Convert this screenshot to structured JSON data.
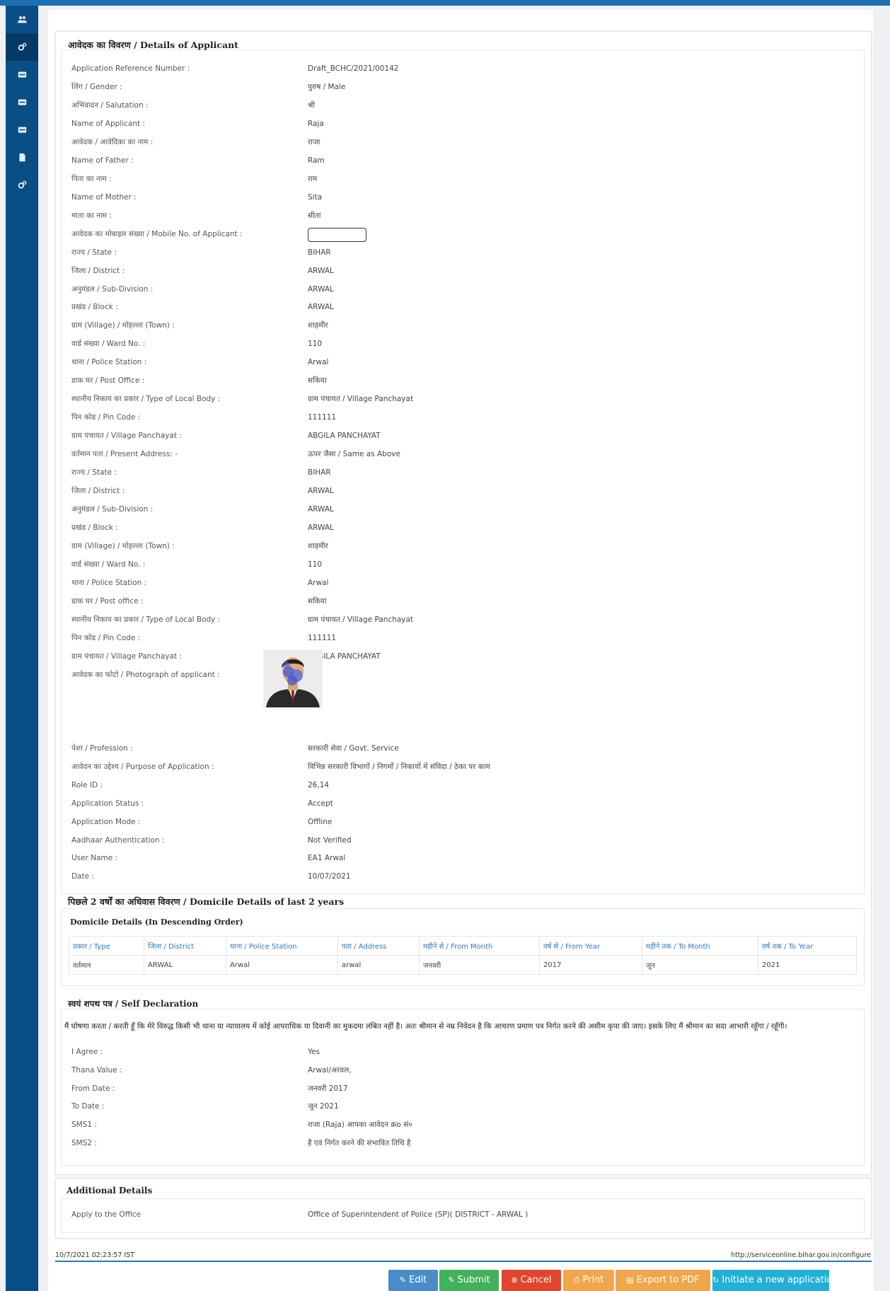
{
  "applicant": {
    "title": "आवेदक का विवरण / Details of Applicant",
    "fields": [
      {
        "label": "Application Reference Number :",
        "value": "Draft_BCHC/2021/00142"
      },
      {
        "label": "लिंग / Gender :",
        "value": "पुरुष / Male"
      },
      {
        "label": "अभिवादन / Salutation :",
        "value": "श्री"
      },
      {
        "label": "Name of Applicant :",
        "value": "Raja"
      },
      {
        "label": "आवेदक / आवेदिका का नाम :",
        "value": "राजा"
      },
      {
        "label": "Name of Father :",
        "value": "Ram"
      },
      {
        "label": "पिता का नाम :",
        "value": "राम"
      },
      {
        "label": "Name of Mother :",
        "value": "Sita"
      },
      {
        "label": "माता का नाम :",
        "value": "सीता"
      },
      {
        "label": "आवेदक का मोबाइल संख्या / Mobile No. of Applicant :",
        "value": ""
      },
      {
        "label": "राज्य / State :",
        "value": "BIHAR"
      },
      {
        "label": "जिला / District :",
        "value": "ARWAL"
      },
      {
        "label": "अनुमंडल / Sub-Division :",
        "value": "ARWAL"
      },
      {
        "label": "प्रखंड / Block :",
        "value": "ARWAL"
      },
      {
        "label": "ग्राम (Village) / मोहल्ला (Town) :",
        "value": "शाहमीर"
      },
      {
        "label": "वार्ड संख्या / Ward No. :",
        "value": "110"
      },
      {
        "label": "थाना / Police Station :",
        "value": "Arwal"
      },
      {
        "label": "डाक घर / Post Office :",
        "value": "सकिया"
      },
      {
        "label": "स्थानीय निकाय का प्रकार / Type of Local Body :",
        "value": "ग्राम पंचायत / Village Panchayat"
      },
      {
        "label": "पिन कोड / Pin Code :",
        "value": "111111"
      },
      {
        "label": "ग्राम पंचायत / Village Panchayat :",
        "value": "ABGILA PANCHAYAT"
      },
      {
        "label": "वर्तमान पता / Present Address: -",
        "value": "ऊपर जैसा / Same as Above"
      },
      {
        "label": "राज्य / State :",
        "value": "BIHAR"
      },
      {
        "label": "जिला / District :",
        "value": "ARWAL"
      },
      {
        "label": "अनुमंडल / Sub-Division :",
        "value": "ARWAL"
      },
      {
        "label": "प्रखंड / Block :",
        "value": "ARWAL"
      },
      {
        "label": "ग्राम (Village) / मोहल्ला (Town) :",
        "value": "शाहमीर"
      },
      {
        "label": "वार्ड संख्या / Ward No. :",
        "value": "110"
      },
      {
        "label": "थाना / Police Station :",
        "value": "Arwal"
      },
      {
        "label": "डाक घर / Post office :",
        "value": "सकिया"
      },
      {
        "label": "स्थानीय निकाय का प्रकार / Type of Local Body :",
        "value": "ग्राम पंचायत / Village Panchayat"
      },
      {
        "label": "पिन कोड / Pin Code :",
        "value": "111111"
      },
      {
        "label": "ग्राम पंचायत / Village Panchayat :",
        "value": "ABGILA PANCHAYAT"
      },
      {
        "label": "आवेदक का फोटो / Photograph of applicant :",
        "value": ""
      }
    ],
    "fields2": [
      {
        "label": "पेशा / Profession :",
        "value": "सरकारी सेवा / Govt. Service"
      },
      {
        "label": "आवेदन का उद्देश्य / Purpose of Application :",
        "value": "विभिन्न सरकारी विभागों / निगमों / निकायों में संविदा / ठेका पर काम"
      },
      {
        "label": "Role ID :",
        "value": "26,14"
      },
      {
        "label": "Application Status :",
        "value": "Accept"
      },
      {
        "label": "Application Mode :",
        "value": "Offline"
      },
      {
        "label": "Aadhaar Authentication :",
        "value": "Not Verified"
      },
      {
        "label": "User Name :",
        "value": "EA1 Arwal"
      },
      {
        "label": "Date :",
        "value": "10/07/2021"
      }
    ]
  },
  "domicile": {
    "title": "पिछले 2 वर्षों का अधिवास विवरण / Domicile Details of last 2 years",
    "subtitle": "Domicile Details (In Descending Order)",
    "headers": [
      "प्रकार / Type",
      "जिला / District",
      "थाना / Police Station",
      "पता / Address",
      "महीने से / From Month",
      "वर्ष से / From Year",
      "महीने तक / To Month",
      "वर्ष तक / To Year"
    ],
    "rows": [
      [
        "वर्तमान",
        "ARWAL",
        "Arwal",
        "arwal",
        "जनवरी",
        "2017",
        "जून",
        "2021"
      ]
    ]
  },
  "declaration": {
    "title": "स्वयं शपथ पत्र / Self Declaration",
    "text": "मैं घोषणा करता / करती हूँ कि मेरे विरुद्ध किसी भी थाना या न्यायालय में कोई आपराधिक या दिवानी का मुकदमा लंबित नहीं है। अतः श्रीमान से नम्र निवेदन है कि आचरण प्रमाण पत्र निर्गत करने की असीम कृपा की जाए। इसके लिए मैं श्रीमान का सदा आभारी रहूँगा / रहूँगी।",
    "fields": [
      {
        "label": "I Agree :",
        "value": "Yes"
      },
      {
        "label": "Thana Value :",
        "value": "Arwal/अरवल,"
      },
      {
        "label": "From Date :",
        "value": "जनवरी 2017"
      },
      {
        "label": "To Date :",
        "value": "जून 2021"
      },
      {
        "label": "SMS1 :",
        "value": "राजा (Raja) आपका आवेदन क्रo सं०"
      },
      {
        "label": "SMS2 :",
        "value": "है एवं निर्गत करने की संभावित तिथि है"
      }
    ]
  },
  "additional": {
    "title": "Additional Details",
    "fields": [
      {
        "label": "Apply to the Office",
        "value": "Office of Superintendent of Police (SP)( DISTRICT - ARWAL )"
      }
    ]
  },
  "footer": {
    "timestamp": "10/7/2021 02:23:57 IST",
    "url": "http://serviceonline.bihar.gov.in/configure"
  },
  "buttons": {
    "edit": "Edit",
    "submit": "Submit",
    "cancel": "Cancel",
    "print": "Print",
    "export_pdf": "Export to PDF",
    "initiate": "Initiate a new application"
  },
  "colors": {
    "edit": "#4a8cc9",
    "submit": "#41b15a",
    "cancel": "#e0452e",
    "print": "#f0a64a",
    "export": "#f0a64a",
    "initiate": "#22b0d6",
    "sidebar": "#0a4e86"
  },
  "icons": {
    "sidebar": [
      "users-icon",
      "cogs-icon",
      "card-icon",
      "card-icon",
      "card-icon",
      "file-icon",
      "cogs-icon"
    ]
  }
}
